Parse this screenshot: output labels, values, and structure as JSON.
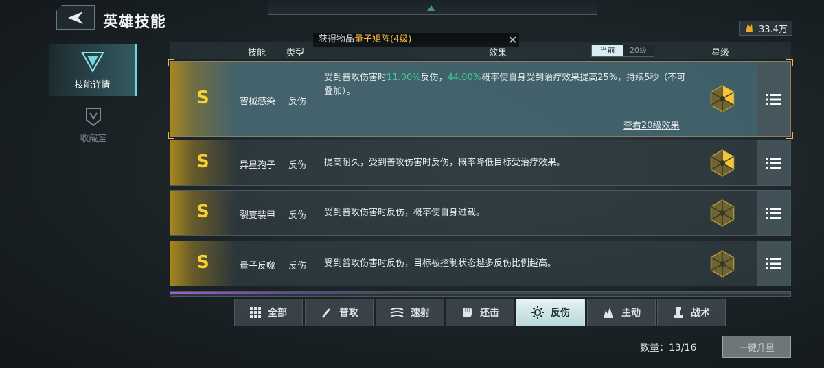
{
  "header": {
    "title": "英雄技能"
  },
  "currency": {
    "amount": "33.4万",
    "icon": "gold-crystal-icon"
  },
  "sidebar": {
    "items": [
      {
        "label": "技能详情",
        "icon": "v-emblem-icon",
        "active": true
      },
      {
        "label": "收藏室",
        "icon": "collection-shield-icon",
        "active": false
      }
    ]
  },
  "notification": {
    "prefix": "获得物品",
    "item": "量子矩阵(4级)"
  },
  "table": {
    "headers": {
      "skill": "技能",
      "type": "类型",
      "effect": "效果",
      "star": "星级"
    },
    "toggle": {
      "current": "当前",
      "level20": "20级"
    }
  },
  "rows": [
    {
      "rank": "S",
      "name": "智械感染",
      "type": "反伤",
      "effect_parts": [
        "受到普攻伤害时",
        "11.00%",
        "反伤，",
        "44.00%",
        "概率使自身受到治疗效果提高25%，持续5秒（不可叠加）。"
      ],
      "link": "查看20级效果",
      "stars": 2
    },
    {
      "rank": "S",
      "name": "异星孢子",
      "type": "反伤",
      "effect": "提高耐久，受到普攻伤害时反伤，概率降低目标受治疗效果。",
      "stars": 2
    },
    {
      "rank": "S",
      "name": "裂变装甲",
      "type": "反伤",
      "effect": "受到普攻伤害时反伤，概率使自身过载。",
      "stars": 0
    },
    {
      "rank": "S",
      "name": "量子反噬",
      "type": "反伤",
      "effect": "受到普攻伤害时反伤，目标被控制状态越多反伤比例越高。",
      "stars": 0
    }
  ],
  "tabs": [
    {
      "label": "全部",
      "icon": "grid-icon"
    },
    {
      "label": "普攻",
      "icon": "bullet-icon"
    },
    {
      "label": "速射",
      "icon": "rapid-fire-icon"
    },
    {
      "label": "还击",
      "icon": "fist-icon"
    },
    {
      "label": "反伤",
      "icon": "gear-burst-icon",
      "active": true
    },
    {
      "label": "主动",
      "icon": "flame-icon"
    },
    {
      "label": "战术",
      "icon": "tower-icon"
    }
  ],
  "footer": {
    "count": "数量：13/16",
    "upgrade_button": "一键升星"
  },
  "colors": {
    "accent_gold": "#f7d132",
    "highlight_green": "#42c79a",
    "notif_orange": "#f5b944"
  }
}
